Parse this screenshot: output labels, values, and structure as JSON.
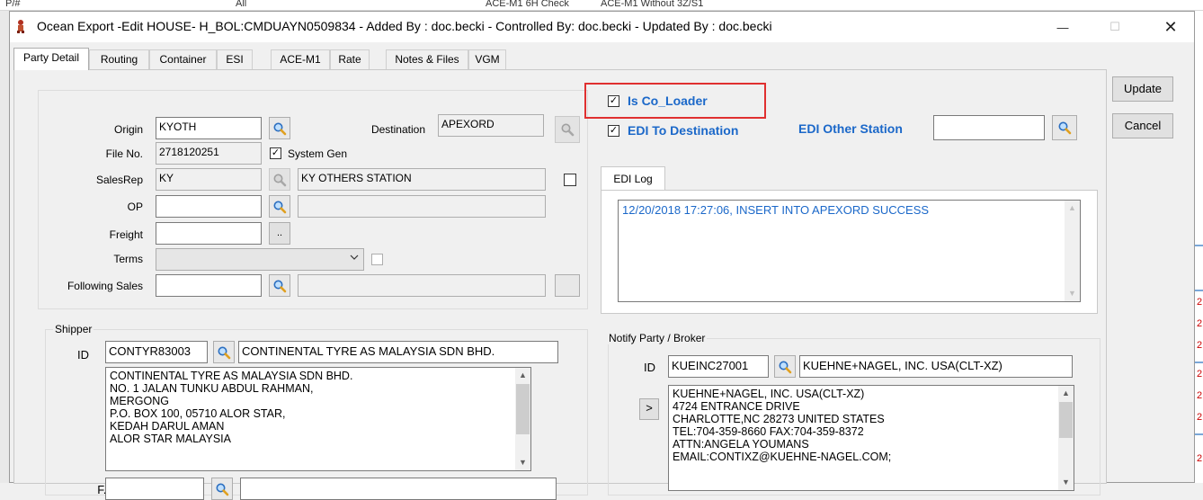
{
  "background": {
    "strip": [
      "P/#",
      "All",
      "ACE-M1 6H Check",
      "ACE-M1 Without 3Z/S1"
    ],
    "right_numbers": [
      "2",
      "2",
      "2",
      "2",
      "2",
      "2",
      "2"
    ]
  },
  "window": {
    "title": "Ocean Export -Edit HOUSE- H_BOL:CMDUAYN0509834 - Added By : doc.becki - Controlled By: doc.becki - Updated By : doc.becki",
    "controls": {
      "minimize": "—",
      "maximize": "☐",
      "close": "✕"
    }
  },
  "tabs": [
    {
      "label": "Party Detail",
      "active": true
    },
    {
      "label": "Routing"
    },
    {
      "label": "Container"
    },
    {
      "label": "ESI"
    },
    {
      "label": "ACE-M1"
    },
    {
      "label": "Rate"
    },
    {
      "label": "Notes & Files"
    },
    {
      "label": "VGM"
    }
  ],
  "actions": {
    "update": "Update",
    "cancel": "Cancel"
  },
  "main": {
    "origin_label": "Origin",
    "origin_value": "KYOTH",
    "destination_label": "Destination",
    "destination_value": "APEXORD",
    "file_no_label": "File No.",
    "file_no_value": "2718120251",
    "system_gen_label": "System Gen",
    "system_gen_checked": "✓",
    "salesrep_label": "SalesRep",
    "salesrep_code": "KY",
    "salesrep_name": "KY OTHERS STATION",
    "op_label": "OP",
    "op_value": "",
    "op_name": "",
    "freight_label": "Freight",
    "freight_value": "",
    "freight_btn": "..",
    "terms_label": "Terms",
    "terms_value": "",
    "following_sales_label": "Following Sales",
    "following_sales_value": "",
    "following_sales_name": ""
  },
  "edi": {
    "is_co_loader_label": "Is Co_Loader",
    "is_co_loader_checked": "✓",
    "edi_to_dest_label": "EDI To Destination",
    "edi_to_dest_checked": "✓",
    "other_station_label": "EDI Other Station",
    "other_station_value": "",
    "log_tab": "EDI Log",
    "log_text": "12/20/2018 17:27:06, INSERT INTO APEXORD SUCCESS"
  },
  "shipper": {
    "legend": "Shipper",
    "id_label": "ID",
    "id_value": "CONTYR83003",
    "name": "CONTINENTAL TYRE AS MALAYSIA SDN BHD.",
    "address": [
      "CONTINENTAL TYRE AS MALAYSIA SDN BHD.",
      "NO. 1 JALAN TUNKU ABDUL RAHMAN,",
      "MERGONG",
      "P.O. BOX 100, 05710 ALOR STAR,",
      "KEDAH DARUL AMAN",
      "ALOR STAR  MALAYSIA"
    ],
    "fs_label": "F.S",
    "fs_value": "",
    "fs_name": ""
  },
  "notify": {
    "legend": "Notify Party / Broker",
    "id_label": "ID",
    "id_value": "KUEINC27001",
    "name": "KUEHNE+NAGEL, INC. USA(CLT-XZ)",
    "copy_btn": ">",
    "address": [
      "KUEHNE+NAGEL, INC. USA(CLT-XZ)",
      "4724 ENTRANCE DRIVE",
      "CHARLOTTE,NC 28273 UNITED STATES",
      "TEL:704-359-8660  FAX:704-359-8372",
      "ATTN:ANGELA YOUMANS",
      "EMAIL:CONTIXZ@KUEHNE-NAGEL.COM;"
    ]
  },
  "scroll_glyphs": {
    "up": "▲",
    "down": "▼"
  }
}
